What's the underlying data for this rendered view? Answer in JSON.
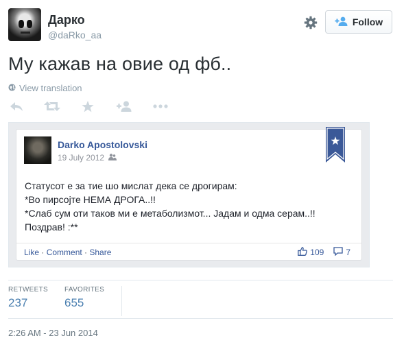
{
  "header": {
    "fullname": "Дарко",
    "screen_name": "@daRko_aa",
    "follow_label": "Follow"
  },
  "tweet": {
    "text": "Му кажав на овие од фб..",
    "view_translation": "View translation",
    "actions": [
      "reply-icon",
      "retweet-icon",
      "favorite-icon",
      "follow-icon",
      "more-icon"
    ]
  },
  "fb_post": {
    "author": "Darko Apostolovski",
    "date": "19 July 2012",
    "lines": [
      "Статусот е за тие шо мислат дека се дрогирам:",
      "*Во пирсојте НЕМА ДРОГА..!!",
      "*Слаб сум оти таков ми е метаболизмот... Јадам и одма серам..!!",
      "Поздрав! :**"
    ],
    "like_label": "Like",
    "comment_label": "Comment",
    "share_label": "Share",
    "separator": " · ",
    "likes": "109",
    "comments": "7"
  },
  "stats": {
    "retweets_label": "RETWEETS",
    "retweets": "237",
    "favorites_label": "FAVORITES",
    "favorites": "655"
  },
  "timestamp": "2:26 AM - 23 Jun 2014",
  "colors": {
    "text": "#292f33",
    "muted": "#8899a6",
    "fb_blue": "#365899",
    "stat_blue": "#4a7fb0",
    "bookmark": "#3b5998"
  }
}
